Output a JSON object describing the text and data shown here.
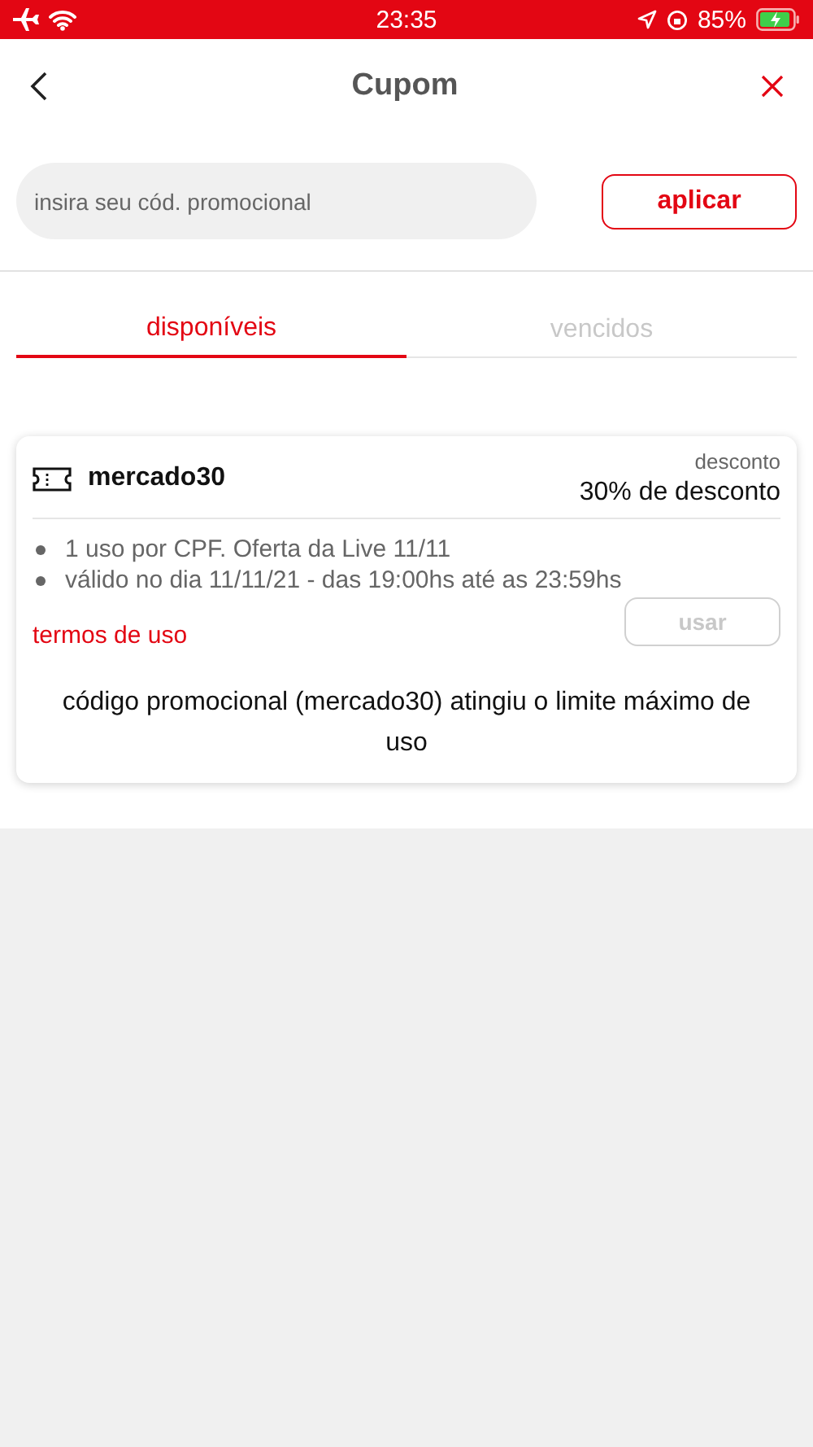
{
  "status_bar": {
    "time": "23:35",
    "battery": "85%"
  },
  "header": {
    "title": "Cupom"
  },
  "promo": {
    "placeholder": "insira seu cód. promocional",
    "button": "aplicar"
  },
  "tabs": [
    {
      "label": "disponíveis",
      "selected": true
    },
    {
      "label": "vencidos",
      "selected": false
    }
  ],
  "coupons": [
    {
      "code": "mercado30",
      "discount_label": "desconto",
      "discount": "30% de desconto",
      "rules": [
        "1 uso por CPF. Oferta da Live 11/11",
        "válido no dia 11/11/21 - das 19:00hs até as 23:59hs"
      ],
      "terms": "termos de uso",
      "button": "usar",
      "disabled": true,
      "message": "código promocional (mercado30) atingiu o limite máximo de uso"
    }
  ]
}
